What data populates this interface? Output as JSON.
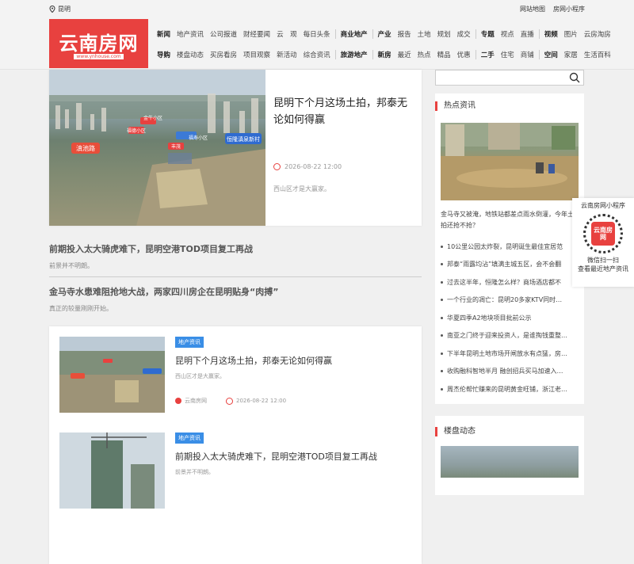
{
  "topbar": {
    "location": "昆明",
    "links": [
      "网站地图",
      "房网小程序"
    ]
  },
  "logo": {
    "title": "云南房网",
    "url": "www.ynhouse.com"
  },
  "nav": {
    "row1": [
      [
        "新闻",
        "地产资讯",
        "公司报道",
        "财经要闻",
        "云　观",
        "每日头条"
      ],
      [
        "商业地产"
      ],
      [
        "产业",
        "报告",
        "土地",
        "规划",
        "成交"
      ],
      [
        "专题",
        "视点",
        "直播"
      ],
      [
        "视频",
        "图片",
        "云房淘房"
      ]
    ],
    "row2": [
      [
        "导购",
        "楼盘动态",
        "买房看房",
        "项目观察",
        "新活动",
        "综合资讯"
      ],
      [
        "旅游地产"
      ],
      [
        "新房",
        "最近",
        "热点",
        "精品",
        "优惠"
      ],
      [
        "二手",
        "住宅",
        "商铺"
      ],
      [
        "空间",
        "家居",
        "生活百科"
      ]
    ]
  },
  "hero": {
    "title": "昆明下个月这场土拍，邦泰无论如何得赢",
    "date": "2026-08-22 12:00",
    "desc": "西山区才是大赢家。",
    "labels": [
      "金牛小区",
      "福寿小区",
      "福德小区",
      "滇池路",
      "恒隆滇泉新村",
      "丰茂"
    ]
  },
  "texts": [
    {
      "title": "前期投入太大骑虎难下，昆明空港TOD项目复工再战",
      "desc": "前景并不明朗。"
    },
    {
      "title": "金马寺水患难阻抢地大战，两家四川房企在昆明贴身“肉搏”",
      "desc": "真正的较量刚刚开始。"
    }
  ],
  "cards": [
    {
      "tag": "地产资讯",
      "title": "昆明下个月这场土拍，邦泰无论如何得赢",
      "desc": "西山区才是大赢家。",
      "author": "云南房网",
      "date": "2026-08-22 12:00"
    },
    {
      "tag": "地产资讯",
      "title": "前期投入太大骑虎难下，昆明空港TOD项目复工再战",
      "desc": "前景并不明朗。"
    }
  ],
  "search": {
    "placeholder": ""
  },
  "hot": {
    "title": "热点资讯",
    "caption": "金马寺又被淹，地铁站都差点雨水倒灌，今年土拍还抢不抢？",
    "items": [
      "10公里公园太炸裂，昆明诞生最佳宜居范",
      "邦泰“雨露均沾”填满主城五区，会不会翻",
      "过去这半年，恒隆怎么样？商场酒店都不",
      "一个行业的凋亡：昆明20多家KTV同时…",
      "华夏四季A2地块项目批前公示",
      "南亚之门终于迎来投资人，是谁掏钱重整…",
      "下半年昆明土地市场开闸放水有点猛，房…",
      "收购融科智地半月 融创招兵买马加速入…",
      "周杰伦帮忙赚来的昆明黄金旺铺，浙江老…"
    ]
  },
  "lp": {
    "title": "楼盘动态"
  },
  "qr": {
    "title": "云南房网小程序",
    "badge": "云南房网",
    "line1": "微信扫一扫",
    "line2": "查看最近地产资讯"
  }
}
